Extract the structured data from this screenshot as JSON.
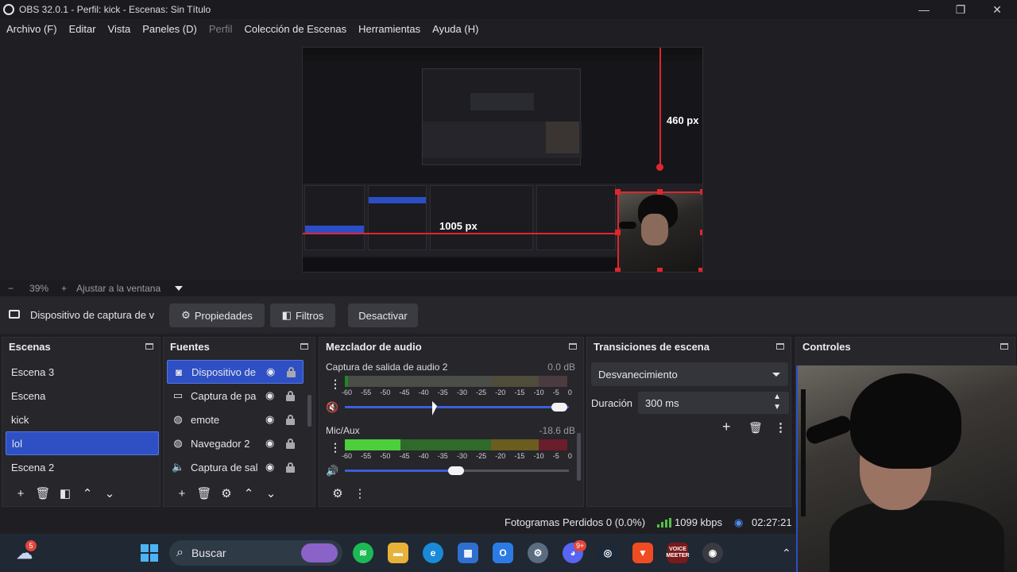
{
  "window": {
    "title": "OBS 32.0.1 - Perfil: kick - Escenas: Sin Título",
    "minimize": "—",
    "maximize": "❐",
    "close": "✕"
  },
  "menu": {
    "items": [
      {
        "label": "Archivo (F)",
        "enabled": true
      },
      {
        "label": "Editar",
        "enabled": true
      },
      {
        "label": "Vista",
        "enabled": true
      },
      {
        "label": "Paneles (D)",
        "enabled": true
      },
      {
        "label": "Perfil",
        "enabled": false
      },
      {
        "label": "Colección de Escenas",
        "enabled": true
      },
      {
        "label": "Herramientas",
        "enabled": true
      },
      {
        "label": "Ayuda (H)",
        "enabled": true
      }
    ]
  },
  "preview": {
    "vertical_measure": "460 px",
    "horizontal_measure": "1005 px"
  },
  "zoom": {
    "minus": "−",
    "value": "39%",
    "plus": "+",
    "fit": "Ajustar a la ventana"
  },
  "source_toolbar": {
    "selected_source": "Dispositivo de captura de v",
    "properties": "Propiedades",
    "filters": "Filtros",
    "deactivate": "Desactivar"
  },
  "scenes": {
    "title": "Escenas",
    "items": [
      "Escena 3",
      "Escena",
      "kick",
      "lol",
      "Escena 2"
    ],
    "selected_index": 3
  },
  "sources": {
    "title": "Fuentes",
    "items": [
      {
        "label": "Dispositivo de",
        "icon": "camera-icon"
      },
      {
        "label": "Captura de pa",
        "icon": "monitor-icon"
      },
      {
        "label": "emote",
        "icon": "globe-icon"
      },
      {
        "label": "Navegador 2",
        "icon": "globe-icon"
      },
      {
        "label": "Captura de sal",
        "icon": "speaker-icon"
      }
    ],
    "selected_index": 0
  },
  "mixer": {
    "title": "Mezclador de audio",
    "scale": [
      "-60",
      "-55",
      "-50",
      "-45",
      "-40",
      "-35",
      "-30",
      "-25",
      "-20",
      "-15",
      "-10",
      "-5",
      "0"
    ],
    "channels": [
      {
        "name": "Captura de salida de audio 2",
        "db": "0.0 dB",
        "muted": true,
        "volume": 1.0
      },
      {
        "name": "Mic/Aux",
        "db": "-18.6 dB",
        "muted": false,
        "volume": 0.5
      }
    ]
  },
  "transitions": {
    "title": "Transiciones de escena",
    "selected": "Desvanecimiento",
    "duration_label": "Duración",
    "duration_value": "300 ms"
  },
  "controls": {
    "title": "Controles"
  },
  "status": {
    "dropped_frames": "Fotogramas Perdidos 0 (0.0%)",
    "bitrate": "1099 kbps",
    "time": "02:27:21"
  },
  "taskbar": {
    "weather_badge": "5",
    "search_placeholder": "Buscar",
    "discord_badge": "9+",
    "voicemeeter_label": "VOICE MEETER"
  },
  "colors": {
    "selection": "#2e50c4",
    "accent_red": "#e0262c",
    "meter_green": "#4ccf3a",
    "meter_yellow": "#c9b321",
    "meter_red": "#b5192a",
    "slider_blue": "#3d5fd6"
  }
}
